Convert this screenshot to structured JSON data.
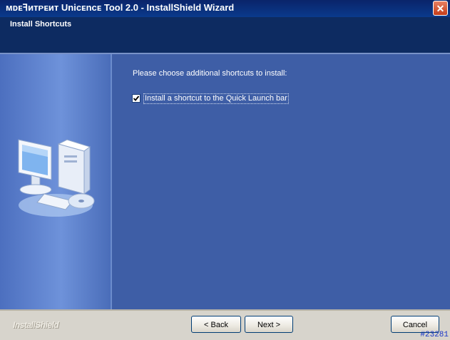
{
  "window": {
    "title": "ᴍᴅᴇꟻᴎᴛᴘᴇᴎᴛ Uniᴄᴇnᴄᴇ Tool 2.0 - InstallShield Wizard",
    "close_glyph": "✕"
  },
  "header": {
    "title": "Install Shortcuts"
  },
  "main": {
    "prompt": "Please choose additional shortcuts to install:",
    "options": [
      {
        "label": "Install a shortcut to the Quick Launch bar",
        "checked": true
      }
    ]
  },
  "footer": {
    "brand": "InstallShield",
    "back_label": "< Back",
    "next_label": "Next >",
    "cancel_label": "Cancel",
    "reference": "#23281"
  },
  "colors": {
    "title_bar": "#0a246a",
    "header_band": "#0d2b61",
    "main_panel": "#3e5ea6",
    "footer": "#d7d4cc"
  }
}
